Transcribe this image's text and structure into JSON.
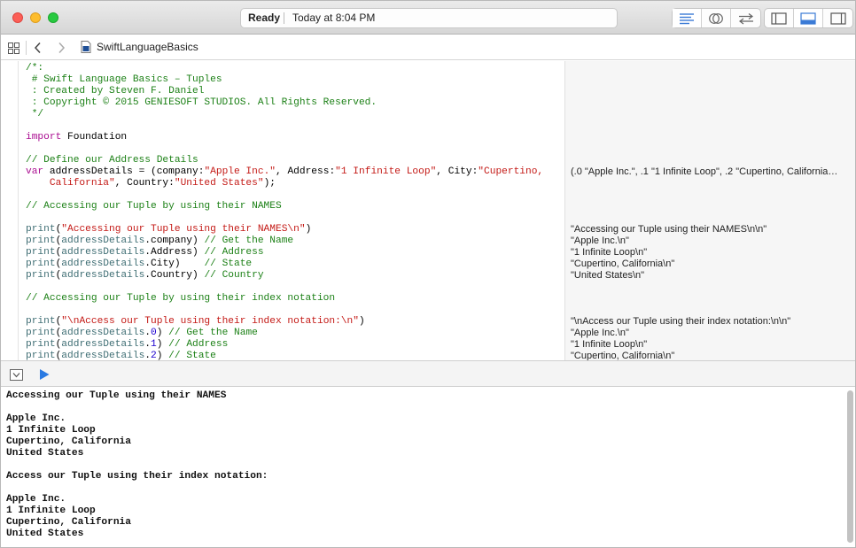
{
  "toolbar": {
    "status_label": "Ready",
    "status_time": "Today at 8:04 PM",
    "buttons": [
      "standard-editor-icon",
      "assistant-editor-icon",
      "version-editor-icon",
      "navigator-toggle-icon",
      "debug-area-toggle-icon",
      "utilities-toggle-icon"
    ]
  },
  "navbar": {
    "file_name": "SwiftLanguageBasics"
  },
  "editor": {
    "lines": [
      [
        {
          "t": "/*:",
          "c": "cm"
        }
      ],
      [
        {
          "t": " # Swift Language Basics – Tuples",
          "c": "cm"
        }
      ],
      [
        {
          "t": " : Created by Steven F. Daniel",
          "c": "cm"
        }
      ],
      [
        {
          "t": " : Copyright © 2015 GENIESOFT STUDIOS. All Rights Reserved.",
          "c": "cm"
        }
      ],
      [
        {
          "t": " */",
          "c": "cm"
        }
      ],
      [],
      [
        {
          "t": "import",
          "c": "kw"
        },
        {
          "t": " Foundation",
          "c": ""
        }
      ],
      [],
      [
        {
          "t": "// Define our Address Details",
          "c": "cm"
        }
      ],
      [
        {
          "t": "var",
          "c": "kw"
        },
        {
          "t": " addressDetails = (company:",
          "c": ""
        },
        {
          "t": "\"Apple Inc.\"",
          "c": "str"
        },
        {
          "t": ", Address:",
          "c": ""
        },
        {
          "t": "\"1 Infinite Loop\"",
          "c": "str"
        },
        {
          "t": ", City:",
          "c": ""
        },
        {
          "t": "\"Cupertino,",
          "c": "str"
        }
      ],
      [
        {
          "t": "    California\"",
          "c": "str"
        },
        {
          "t": ", Country:",
          "c": ""
        },
        {
          "t": "\"United States\"",
          "c": "str"
        },
        {
          "t": ");",
          "c": ""
        }
      ],
      [],
      [
        {
          "t": "// Accessing our Tuple by using their NAMES",
          "c": "cm"
        }
      ],
      [],
      [
        {
          "t": "print",
          "c": "fn"
        },
        {
          "t": "(",
          "c": ""
        },
        {
          "t": "\"Accessing our Tuple using their NAMES\\n\"",
          "c": "str"
        },
        {
          "t": ")",
          "c": ""
        }
      ],
      [
        {
          "t": "print",
          "c": "fn"
        },
        {
          "t": "(",
          "c": ""
        },
        {
          "t": "addressDetails",
          "c": "prop"
        },
        {
          "t": ".company) ",
          "c": ""
        },
        {
          "t": "// Get the Name",
          "c": "cm"
        }
      ],
      [
        {
          "t": "print",
          "c": "fn"
        },
        {
          "t": "(",
          "c": ""
        },
        {
          "t": "addressDetails",
          "c": "prop"
        },
        {
          "t": ".Address) ",
          "c": ""
        },
        {
          "t": "// Address",
          "c": "cm"
        }
      ],
      [
        {
          "t": "print",
          "c": "fn"
        },
        {
          "t": "(",
          "c": ""
        },
        {
          "t": "addressDetails",
          "c": "prop"
        },
        {
          "t": ".City)    ",
          "c": ""
        },
        {
          "t": "// State",
          "c": "cm"
        }
      ],
      [
        {
          "t": "print",
          "c": "fn"
        },
        {
          "t": "(",
          "c": ""
        },
        {
          "t": "addressDetails",
          "c": "prop"
        },
        {
          "t": ".Country) ",
          "c": ""
        },
        {
          "t": "// Country",
          "c": "cm"
        }
      ],
      [],
      [
        {
          "t": "// Accessing our Tuple by using their index notation",
          "c": "cm"
        }
      ],
      [],
      [
        {
          "t": "print",
          "c": "fn"
        },
        {
          "t": "(",
          "c": ""
        },
        {
          "t": "\"\\nAccess our Tuple using their index notation:\\n\"",
          "c": "str"
        },
        {
          "t": ")",
          "c": ""
        }
      ],
      [
        {
          "t": "print",
          "c": "fn"
        },
        {
          "t": "(",
          "c": ""
        },
        {
          "t": "addressDetails",
          "c": "prop"
        },
        {
          "t": ".",
          "c": ""
        },
        {
          "t": "0",
          "c": "num"
        },
        {
          "t": ") ",
          "c": ""
        },
        {
          "t": "// Get the Name",
          "c": "cm"
        }
      ],
      [
        {
          "t": "print",
          "c": "fn"
        },
        {
          "t": "(",
          "c": ""
        },
        {
          "t": "addressDetails",
          "c": "prop"
        },
        {
          "t": ".",
          "c": ""
        },
        {
          "t": "1",
          "c": "num"
        },
        {
          "t": ") ",
          "c": ""
        },
        {
          "t": "// Address",
          "c": "cm"
        }
      ],
      [
        {
          "t": "print",
          "c": "fn"
        },
        {
          "t": "(",
          "c": ""
        },
        {
          "t": "addressDetails",
          "c": "prop"
        },
        {
          "t": ".",
          "c": ""
        },
        {
          "t": "2",
          "c": "num"
        },
        {
          "t": ") ",
          "c": ""
        },
        {
          "t": "// State",
          "c": "cm"
        }
      ]
    ],
    "results": [
      {
        "line": 9,
        "text": "(.0 \"Apple Inc.\", .1 \"1 Infinite Loop\", .2 \"Cupertino, California…"
      },
      {
        "line": 14,
        "text": "\"Accessing our Tuple using their NAMES\\n\\n\""
      },
      {
        "line": 15,
        "text": "\"Apple Inc.\\n\""
      },
      {
        "line": 16,
        "text": "\"1 Infinite Loop\\n\""
      },
      {
        "line": 17,
        "text": "\"Cupertino, California\\n\""
      },
      {
        "line": 18,
        "text": "\"United States\\n\""
      },
      {
        "line": 22,
        "text": "\"\\nAccess our Tuple using their index notation:\\n\\n\""
      },
      {
        "line": 23,
        "text": "\"Apple Inc.\\n\""
      },
      {
        "line": 24,
        "text": "\"1 Infinite Loop\\n\""
      },
      {
        "line": 25,
        "text": "\"Cupertino, California\\n\""
      }
    ]
  },
  "console": {
    "lines": [
      "Accessing our Tuple using their NAMES",
      "",
      "Apple Inc.",
      "1 Infinite Loop",
      "Cupertino, California",
      "United States",
      "",
      "Access our Tuple using their index notation:",
      "",
      "Apple Inc.",
      "1 Infinite Loop",
      "Cupertino, California",
      "United States"
    ]
  }
}
